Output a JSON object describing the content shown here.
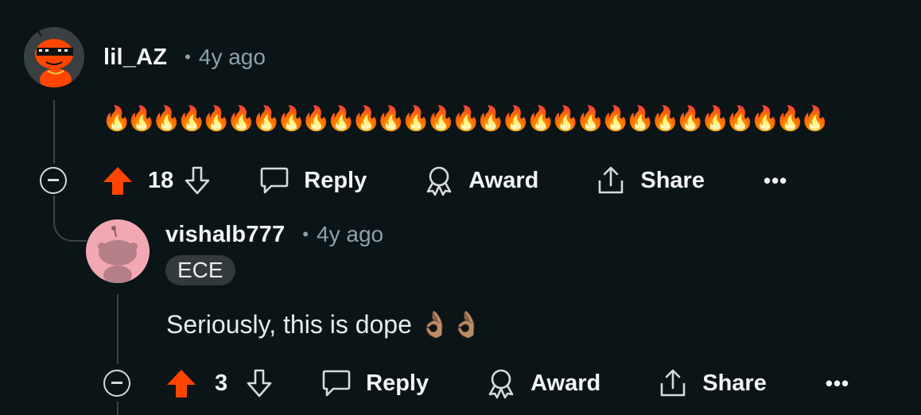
{
  "comments": [
    {
      "username": "lil_AZ",
      "separator": "•",
      "timestamp": "4y ago",
      "body": "🔥🔥🔥🔥🔥🔥🔥🔥🔥🔥🔥🔥🔥🔥🔥🔥🔥🔥🔥🔥🔥🔥🔥🔥🔥🔥🔥🔥🔥",
      "votes": "18",
      "reply_label": "Reply",
      "award_label": "Award",
      "share_label": "Share",
      "more_label": "•••",
      "upvoted": true
    },
    {
      "username": "vishalb777",
      "separator": "•",
      "timestamp": "4y ago",
      "flair": "ECE",
      "body": "Seriously, this is dope 👌🏽👌🏽",
      "votes": "3",
      "reply_label": "Reply",
      "award_label": "Award",
      "share_label": "Share",
      "more_label": "•••",
      "upvoted": true
    }
  ],
  "colors": {
    "background": "#0b1416",
    "upvote_active": "#ff4500",
    "avatar1_bg": "#3a3f42",
    "avatar2_bg": "#f2a8b3",
    "muted_text": "#8ba2ad",
    "thread_line": "#3c4449"
  },
  "icons": {
    "upvote": "upvote-arrow-icon",
    "downvote": "downvote-arrow-icon",
    "reply": "speech-bubble-icon",
    "award": "award-ribbon-icon",
    "share": "share-upload-icon",
    "collapse": "minus-circle-icon"
  }
}
